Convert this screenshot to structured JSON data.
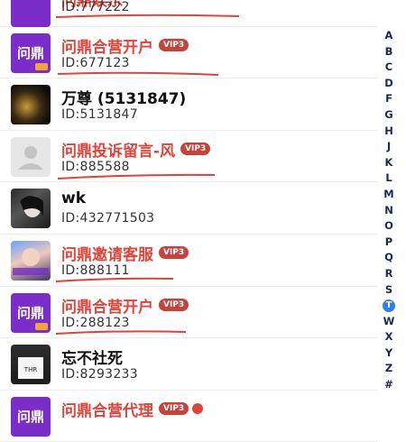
{
  "contacts": [
    {
      "name": "问鼎娱乐",
      "id": "ID:777222",
      "highlight": true,
      "vip": "",
      "avatar_icon": "wending-brand-icon"
    },
    {
      "name": "问鼎合营开户",
      "id": "ID:677123",
      "highlight": true,
      "vip": "VIP3",
      "avatar_icon": "wending-brand-icon",
      "avatar_text": "问鼎"
    },
    {
      "name": "万尊 (5131847)",
      "id": "ID:5131847",
      "highlight": false,
      "vip": "",
      "avatar_icon": "dark-photo-avatar"
    },
    {
      "name": "问鼎投诉留言-风",
      "id": "ID:885588",
      "highlight": true,
      "vip": "VIP3",
      "avatar_icon": "default-user-icon"
    },
    {
      "name": "wk",
      "id": "ID:432771503",
      "highlight": false,
      "vip": "",
      "avatar_icon": "photo-avatar"
    },
    {
      "name": "问鼎邀请客服",
      "id": "ID:888111",
      "highlight": true,
      "vip": "VIP3",
      "avatar_icon": "girl-photo-avatar"
    },
    {
      "name": "问鼎合营开户",
      "id": "ID:288123",
      "highlight": true,
      "vip": "VIP3",
      "avatar_icon": "wending-brand-icon",
      "avatar_text": "问鼎"
    },
    {
      "name": "忘不社死",
      "id": "ID:8293233",
      "highlight": false,
      "vip": "",
      "avatar_icon": "shirt-photo-avatar"
    },
    {
      "name": "问鼎合营代理",
      "id": "",
      "highlight": true,
      "vip": "VIP3",
      "avatar_icon": "wending-brand-icon",
      "avatar_text": "问鼎"
    }
  ],
  "index_letters": [
    "A",
    "B",
    "C",
    "D",
    "F",
    "G",
    "H",
    "J",
    "K",
    "L",
    "M",
    "N",
    "O",
    "P",
    "Q",
    "R",
    "S",
    "T",
    "W",
    "X",
    "Y",
    "Z",
    "#"
  ],
  "active_letter": "T",
  "colors": {
    "highlight_text": "#e0433a",
    "vip_badge": "#c8423c",
    "active_index": "#2f80ed"
  }
}
